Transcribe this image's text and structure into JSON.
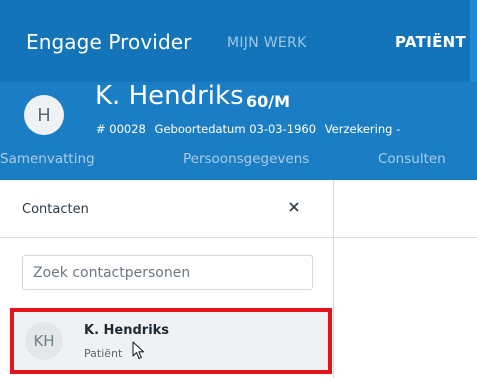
{
  "app": {
    "brand": "Engage Provider",
    "nav": [
      {
        "label": "MIJN WERK",
        "active": false
      },
      {
        "label": "PATIËNT",
        "active": true
      }
    ]
  },
  "patient": {
    "initials": "H",
    "name": "K. Hendriks",
    "age_sex": "60/M",
    "id_label": "# 00028",
    "dob_label": "Geboortedatum 03-03-1960",
    "insurance_label": "Verzekering -"
  },
  "tabs": [
    {
      "label": "Samenvatting"
    },
    {
      "label": "Persoonsgegevens"
    },
    {
      "label": "Consulten"
    }
  ],
  "sidebar": {
    "title": "Contacten",
    "close_icon": "close-icon",
    "search": {
      "placeholder": "Zoek contactpersonen",
      "value": ""
    },
    "contacts": [
      {
        "initials": "KH",
        "name": "K. Hendriks",
        "role": "Patiënt",
        "highlighted": true
      }
    ]
  },
  "colors": {
    "header": "#1b7ec4",
    "topbar": "#1474b9",
    "highlight_border": "#e0141a"
  }
}
